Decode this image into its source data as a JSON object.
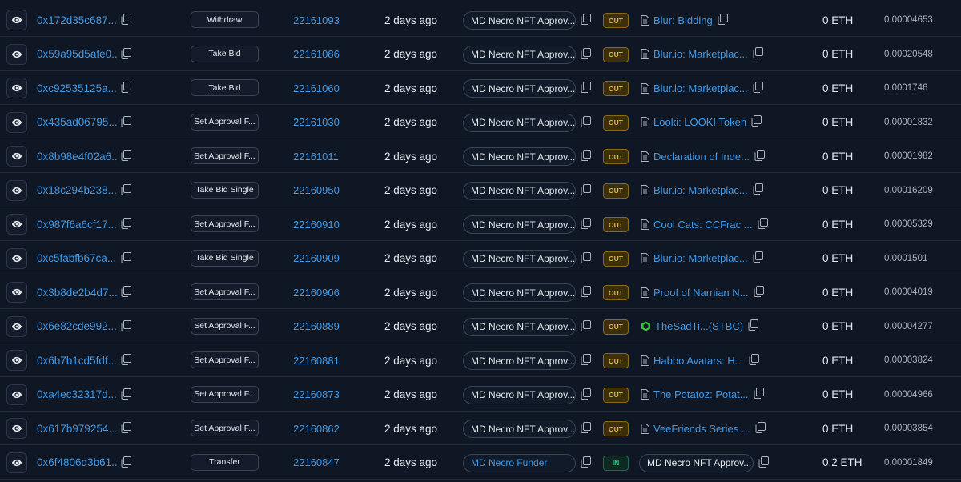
{
  "icons": {
    "view": "eye-icon",
    "copy": "copy-icon",
    "contract": "document-icon",
    "token": "token-icon"
  },
  "colors": {
    "link": "#3f9ae8",
    "out_badge": "#e5b43a",
    "in_badge": "#38c98a",
    "token_icon": "#3fbf3f"
  },
  "transactions": [
    {
      "hash": "0x172d35c687...",
      "method": "Withdraw",
      "block": "22161093",
      "age": "2 days ago",
      "from": "MD Necro NFT Approv...",
      "from_is_link": false,
      "direction": "OUT",
      "to": "Blur: Bidding",
      "to_kind": "contract",
      "value": "0 ETH",
      "fee": "0.00004653"
    },
    {
      "hash": "0x59a95d5afe0...",
      "method": "Take Bid",
      "block": "22161086",
      "age": "2 days ago",
      "from": "MD Necro NFT Approv...",
      "from_is_link": false,
      "direction": "OUT",
      "to": "Blur.io: Marketplac...",
      "to_kind": "contract",
      "value": "0 ETH",
      "fee": "0.00020548"
    },
    {
      "hash": "0xc92535125a...",
      "method": "Take Bid",
      "block": "22161060",
      "age": "2 days ago",
      "from": "MD Necro NFT Approv...",
      "from_is_link": false,
      "direction": "OUT",
      "to": "Blur.io: Marketplac...",
      "to_kind": "contract",
      "value": "0 ETH",
      "fee": "0.0001746"
    },
    {
      "hash": "0x435ad06795...",
      "method": "Set Approval F...",
      "block": "22161030",
      "age": "2 days ago",
      "from": "MD Necro NFT Approv...",
      "from_is_link": false,
      "direction": "OUT",
      "to": "Looki: LOOKI Token",
      "to_kind": "contract",
      "value": "0 ETH",
      "fee": "0.00001832"
    },
    {
      "hash": "0x8b98e4f02a6...",
      "method": "Set Approval F...",
      "block": "22161011",
      "age": "2 days ago",
      "from": "MD Necro NFT Approv...",
      "from_is_link": false,
      "direction": "OUT",
      "to": "Declaration of Inde...",
      "to_kind": "contract",
      "value": "0 ETH",
      "fee": "0.00001982"
    },
    {
      "hash": "0x18c294b238...",
      "method": "Take Bid Single",
      "block": "22160950",
      "age": "2 days ago",
      "from": "MD Necro NFT Approv...",
      "from_is_link": false,
      "direction": "OUT",
      "to": "Blur.io: Marketplac...",
      "to_kind": "contract",
      "value": "0 ETH",
      "fee": "0.00016209"
    },
    {
      "hash": "0x987f6a6cf17...",
      "method": "Set Approval F...",
      "block": "22160910",
      "age": "2 days ago",
      "from": "MD Necro NFT Approv...",
      "from_is_link": false,
      "direction": "OUT",
      "to": "Cool Cats: CCFrac ...",
      "to_kind": "contract",
      "value": "0 ETH",
      "fee": "0.00005329"
    },
    {
      "hash": "0xc5fabfb67ca...",
      "method": "Take Bid Single",
      "block": "22160909",
      "age": "2 days ago",
      "from": "MD Necro NFT Approv...",
      "from_is_link": false,
      "direction": "OUT",
      "to": "Blur.io: Marketplac...",
      "to_kind": "contract",
      "value": "0 ETH",
      "fee": "0.0001501"
    },
    {
      "hash": "0x3b8de2b4d7...",
      "method": "Set Approval F...",
      "block": "22160906",
      "age": "2 days ago",
      "from": "MD Necro NFT Approv...",
      "from_is_link": false,
      "direction": "OUT",
      "to": "Proof of Narnian N...",
      "to_kind": "contract",
      "value": "0 ETH",
      "fee": "0.00004019"
    },
    {
      "hash": "0x6e82cde992...",
      "method": "Set Approval F...",
      "block": "22160889",
      "age": "2 days ago",
      "from": "MD Necro NFT Approv...",
      "from_is_link": false,
      "direction": "OUT",
      "to": "TheSadTi...(STBC)",
      "to_kind": "token",
      "value": "0 ETH",
      "fee": "0.00004277"
    },
    {
      "hash": "0x6b7b1cd5fdf...",
      "method": "Set Approval F...",
      "block": "22160881",
      "age": "2 days ago",
      "from": "MD Necro NFT Approv...",
      "from_is_link": false,
      "direction": "OUT",
      "to": "Habbo Avatars: H...",
      "to_kind": "contract",
      "value": "0 ETH",
      "fee": "0.00003824"
    },
    {
      "hash": "0xa4ec32317d...",
      "method": "Set Approval F...",
      "block": "22160873",
      "age": "2 days ago",
      "from": "MD Necro NFT Approv...",
      "from_is_link": false,
      "direction": "OUT",
      "to": "The Potatoz: Potat...",
      "to_kind": "contract",
      "value": "0 ETH",
      "fee": "0.00004966"
    },
    {
      "hash": "0x617b979254...",
      "method": "Set Approval F...",
      "block": "22160862",
      "age": "2 days ago",
      "from": "MD Necro NFT Approv...",
      "from_is_link": false,
      "direction": "OUT",
      "to": "VeeFriends Series ...",
      "to_kind": "contract",
      "value": "0 ETH",
      "fee": "0.00003854"
    },
    {
      "hash": "0x6f4806d3b61...",
      "method": "Transfer",
      "block": "22160847",
      "age": "2 days ago",
      "from": "MD Necro Funder",
      "from_is_link": true,
      "direction": "IN",
      "to": "MD Necro NFT Approv...",
      "to_kind": "wallet",
      "value": "0.2 ETH",
      "fee": "0.00001849"
    }
  ]
}
